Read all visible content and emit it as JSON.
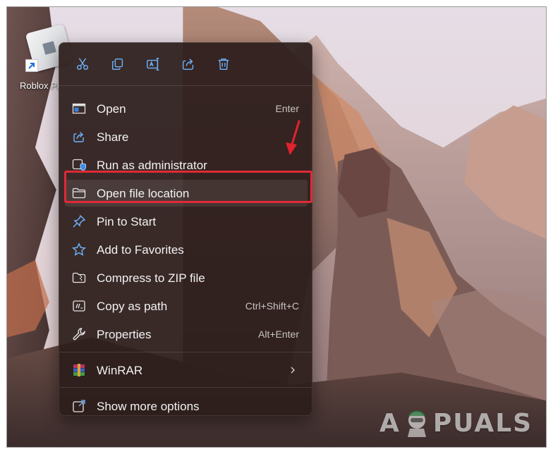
{
  "desktop": {
    "icon_label": "Roblox Pl"
  },
  "menu": {
    "toolbar": [
      {
        "name": "cut-icon"
      },
      {
        "name": "copy-icon"
      },
      {
        "name": "rename-icon"
      },
      {
        "name": "share-icon"
      },
      {
        "name": "delete-icon"
      }
    ],
    "items": [
      {
        "label": "Open",
        "shortcut": "Enter",
        "icon": "open-app-icon"
      },
      {
        "label": "Share",
        "shortcut": "",
        "icon": "share-icon"
      },
      {
        "label": "Run as administrator",
        "shortcut": "",
        "icon": "admin-shield-icon"
      },
      {
        "label": "Open file location",
        "shortcut": "",
        "icon": "folder-icon"
      },
      {
        "label": "Pin to Start",
        "shortcut": "",
        "icon": "pin-icon"
      },
      {
        "label": "Add to Favorites",
        "shortcut": "",
        "icon": "star-icon"
      },
      {
        "label": "Compress to ZIP file",
        "shortcut": "",
        "icon": "zip-folder-icon"
      },
      {
        "label": "Copy as path",
        "shortcut": "Ctrl+Shift+C",
        "icon": "copy-path-icon"
      },
      {
        "label": "Properties",
        "shortcut": "Alt+Enter",
        "icon": "wrench-icon"
      }
    ],
    "winrar": {
      "label": "WinRAR",
      "icon": "winrar-icon"
    },
    "more": {
      "label": "Show more options",
      "icon": "show-more-icon"
    }
  },
  "watermark": {
    "before": "A",
    "after": "PUALS"
  },
  "colors": {
    "menu_bg": "#2c1d1b",
    "accent_blue": "#60b0ff",
    "highlight_red": "#e02a36",
    "text": "#f2f2f2"
  }
}
